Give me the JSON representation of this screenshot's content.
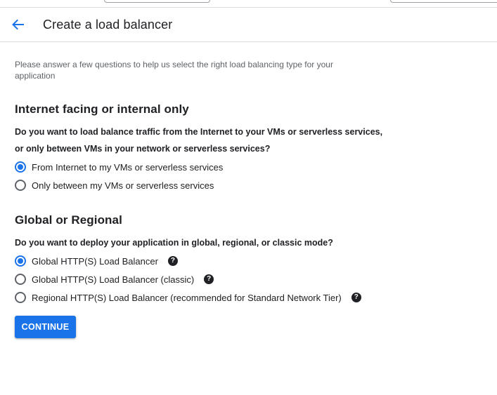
{
  "header": {
    "back_icon": "arrow-back-icon",
    "title": "Create a load balancer"
  },
  "intro": "Please answer a few questions to help us select the right load balancing type for your application",
  "sections": [
    {
      "title": "Internet facing or internal only",
      "question_line1": "Do you want to load balance traffic from the Internet to your VMs or serverless services,",
      "question_line2": "or only between VMs in your network or serverless services?",
      "options": [
        {
          "label": "From Internet to my VMs or serverless services",
          "selected": true
        },
        {
          "label": "Only between my VMs or serverless services",
          "selected": false
        }
      ]
    },
    {
      "title": "Global or Regional",
      "question": "Do you want to deploy your application in global, regional, or classic mode?",
      "options": [
        {
          "label": "Global HTTP(S) Load Balancer",
          "selected": true,
          "help_icon": "?"
        },
        {
          "label": "Global HTTP(S) Load Balancer (classic)",
          "selected": false,
          "help_icon": "?"
        },
        {
          "label": "Regional HTTP(S) Load Balancer (recommended for Standard Network Tier)",
          "selected": false,
          "help_icon": "?"
        }
      ]
    }
  ],
  "continue_label": "CONTINUE",
  "colors": {
    "accent": "#1a73e8",
    "text": "#202124",
    "muted": "#5f6368",
    "divider": "#dadce0"
  }
}
